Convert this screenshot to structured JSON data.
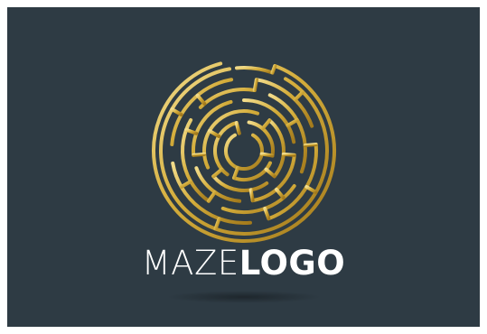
{
  "logo": {
    "brand_light": "MAZE",
    "brand_bold": "LOGO",
    "icon": "circular-maze-icon",
    "colors": {
      "background": "#2e3b44",
      "gold_light": "#f2dc8b",
      "gold_mid": "#d4ad3b",
      "gold_dark": "#a37a1c",
      "text": "#ffffff"
    }
  }
}
